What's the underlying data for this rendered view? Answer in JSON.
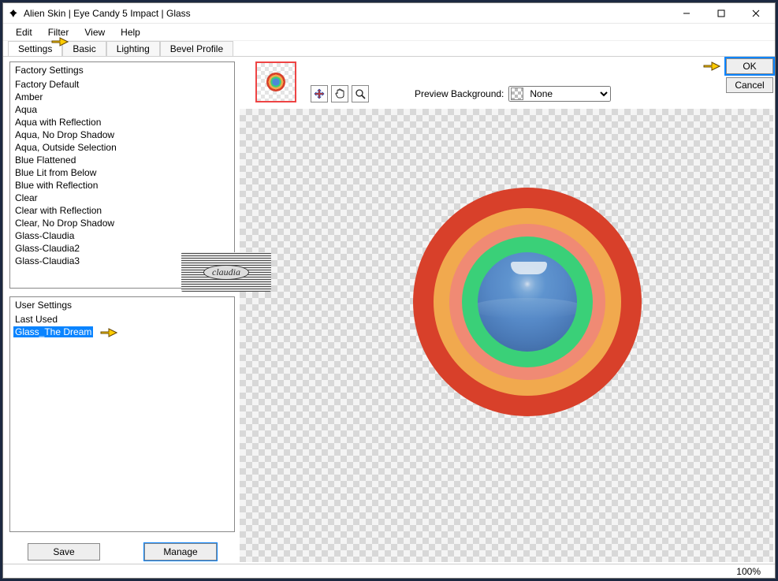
{
  "window": {
    "title": "Alien Skin | Eye Candy 5 Impact | Glass"
  },
  "menu": {
    "items": [
      "Edit",
      "Filter",
      "View",
      "Help"
    ]
  },
  "tabs": {
    "items": [
      "Settings",
      "Basic",
      "Lighting",
      "Bevel Profile"
    ],
    "activeIndex": 0
  },
  "factory": {
    "title": "Factory Settings",
    "items": [
      "Factory Default",
      "Amber",
      "Aqua",
      "Aqua with Reflection",
      "Aqua, No Drop Shadow",
      "Aqua, Outside Selection",
      "Blue Flattened",
      "Blue Lit from Below",
      "Blue with Reflection",
      "Clear",
      "Clear with Reflection",
      "Clear, No Drop Shadow",
      "Glass-Claudia",
      "Glass-Claudia2",
      "Glass-Claudia3"
    ]
  },
  "user": {
    "title": "User Settings",
    "items": [
      "Last Used",
      "Glass_The Dream"
    ],
    "selectedIndex": 1
  },
  "buttons": {
    "save": "Save",
    "manage": "Manage",
    "ok": "OK",
    "cancel": "Cancel"
  },
  "preview": {
    "label": "Preview Background:",
    "selected": "None"
  },
  "status": {
    "zoom": "100%"
  },
  "watermark": "claudia"
}
